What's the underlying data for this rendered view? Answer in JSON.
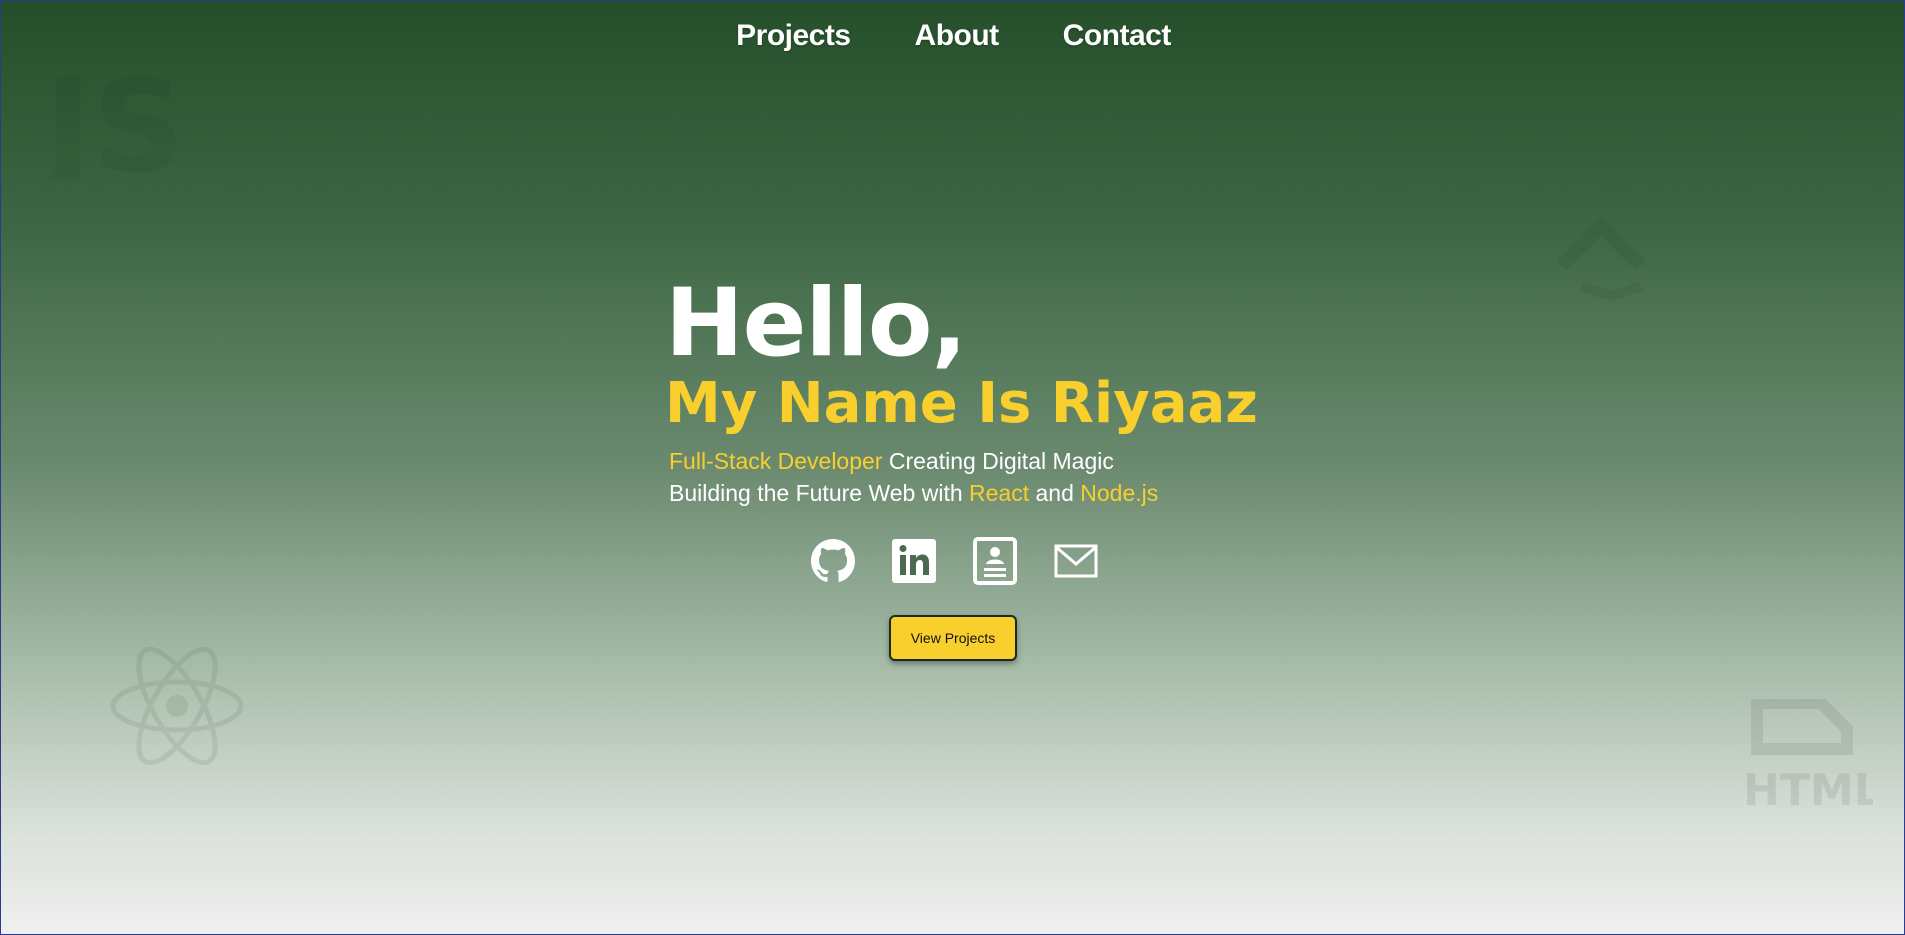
{
  "nav": {
    "items": [
      {
        "label": "Projects"
      },
      {
        "label": "About"
      },
      {
        "label": "Contact"
      }
    ]
  },
  "hero": {
    "greeting": "Hello,",
    "name_line": "My Name Is Riyaaz",
    "line1": {
      "highlight": "Full-Stack Developer",
      "rest": " Creating Digital Magic"
    },
    "line2": {
      "prefix": "Building the Future Web with ",
      "tech1": "React",
      "joiner": " and ",
      "tech2": "Node.js"
    }
  },
  "socials": [
    {
      "icon": "github-icon"
    },
    {
      "icon": "linkedin-icon"
    },
    {
      "icon": "resume-icon"
    },
    {
      "icon": "mail-icon"
    }
  ],
  "cta": {
    "label": "View Projects"
  },
  "background_icons": [
    "js-logo",
    "react-logo",
    "html-logo",
    "code-chevron"
  ],
  "colors": {
    "accent": "#f8cf2c",
    "bg_top": "#244f2a",
    "bg_bottom": "#f0f0f0",
    "text": "#ffffff"
  }
}
